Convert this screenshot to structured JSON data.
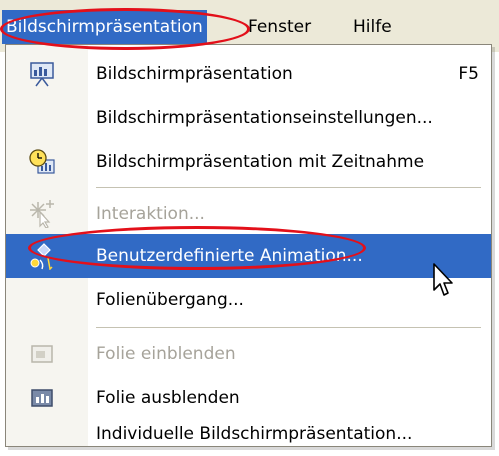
{
  "menubar": {
    "items": [
      {
        "label": "Bildschirmpräsentation"
      },
      {
        "label": "Fenster"
      },
      {
        "label": "Hilfe"
      }
    ]
  },
  "menu": {
    "items": [
      {
        "label": "Bildschirmpräsentation",
        "shortcut": "F5",
        "icon": "slideshow-screen-icon",
        "enabled": true
      },
      {
        "label": "Bildschirmpräsentationseinstellungen...",
        "icon": null,
        "enabled": true
      },
      {
        "label": "Bildschirmpräsentation mit Zeitnahme",
        "icon": "rehearse-timing-clock-icon",
        "enabled": true
      },
      {
        "label": "Interaktion...",
        "icon": "action-settings-icon",
        "enabled": false
      },
      {
        "label": "Benutzerdefinierte Animation...",
        "icon": "custom-animation-icon",
        "enabled": true,
        "highlighted": true
      },
      {
        "label": "Folienübergang...",
        "icon": null,
        "enabled": true
      },
      {
        "label": "Folie einblenden",
        "icon": "show-slide-icon",
        "enabled": false
      },
      {
        "label": "Folie ausblenden",
        "icon": "hide-slide-icon",
        "enabled": true
      },
      {
        "label": "Individuelle Bildschirmpräsentation...",
        "icon": null,
        "enabled": true
      }
    ]
  },
  "colors": {
    "highlight": "#316ac5",
    "annotation": "#e3101a",
    "disabled_text": "#a6a39a"
  }
}
